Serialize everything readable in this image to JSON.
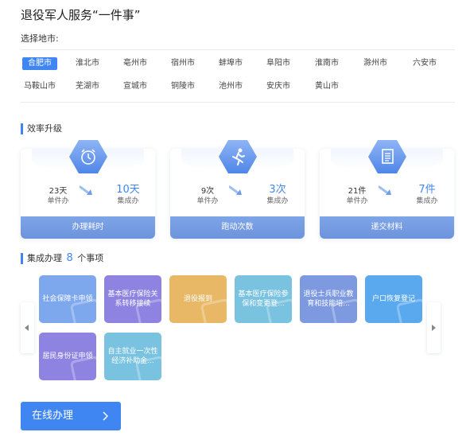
{
  "title": "退役军人服务“一件事”",
  "select_label": "选择地市:",
  "cities_row1": [
    "合肥市",
    "淮北市",
    "亳州市",
    "宿州市",
    "蚌埠市",
    "阜阳市",
    "淮南市",
    "滁州市",
    "六安市"
  ],
  "cities_row2": [
    "马鞍山市",
    "芜湖市",
    "宣城市",
    "铜陵市",
    "池州市",
    "安庆市",
    "黄山市"
  ],
  "active_city": "合肥市",
  "efficiency": {
    "title": "效率升级",
    "cards": [
      {
        "icon": "alarm-clock-icon",
        "before_value": "23天",
        "before_label": "单件办",
        "after_value": "10天",
        "after_label": "集成办",
        "footer": "办理耗时"
      },
      {
        "icon": "running-person-icon",
        "before_value": "9次",
        "before_label": "单件办",
        "after_value": "3次",
        "after_label": "集成办",
        "footer": "跑动次数"
      },
      {
        "icon": "document-icon",
        "before_value": "21件",
        "before_label": "单件办",
        "after_value": "7件",
        "after_label": "集成办",
        "footer": "递交材料"
      }
    ]
  },
  "integrated": {
    "title_prefix": "集成办理",
    "count": "8",
    "title_suffix": "个事项",
    "items": [
      {
        "label": "社会保障卡申领",
        "color": "#7ea8ee"
      },
      {
        "label": "基本医疗保险关系转移接续",
        "color": "#8e83e0"
      },
      {
        "label": "退役报到",
        "color": "#e8b866"
      },
      {
        "label": "基本医疗保险参保和变更登...",
        "color": "#79c2e0"
      },
      {
        "label": "退役士兵职业教育和技能培...",
        "color": "#7d9ae0"
      },
      {
        "label": "户口恢复登记",
        "color": "#5aa9ee"
      },
      {
        "label": "居民身份证申领",
        "color": "#8e83e0"
      },
      {
        "label": "自主就业一次性经济补助金...",
        "color": "#79c2e0"
      }
    ]
  },
  "online_button": "在线办理",
  "colors": {
    "accent": "#3f86f2"
  }
}
